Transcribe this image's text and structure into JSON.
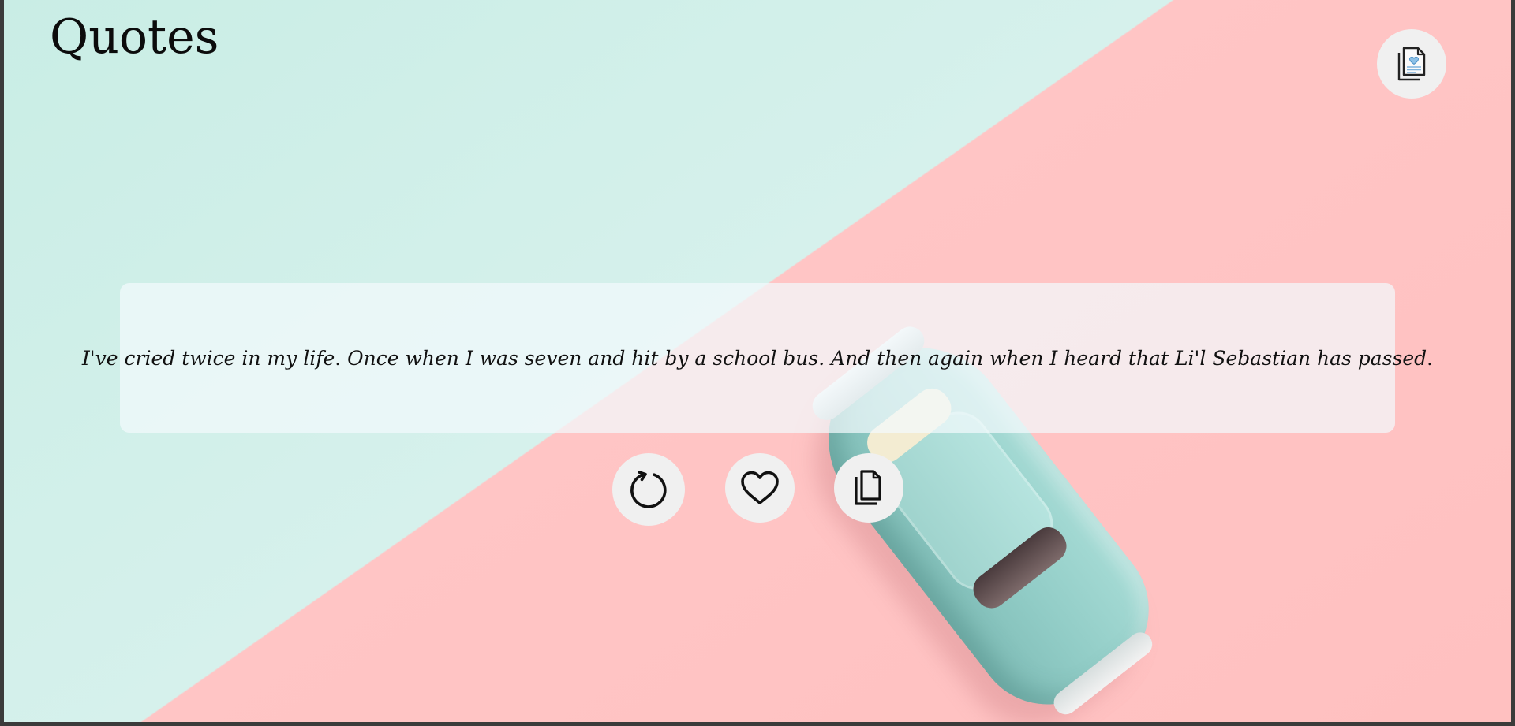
{
  "app": {
    "title": "Quotes"
  },
  "quote": {
    "text": "I've cried twice in my life. Once when I was seven and hit by a school bus. And then again when I heard that Li'l Sebastian has passed."
  },
  "actions": [
    {
      "name": "refresh",
      "icon": "refresh-icon"
    },
    {
      "name": "like",
      "icon": "heart-icon"
    },
    {
      "name": "copy",
      "icon": "copy-icon"
    }
  ],
  "header": {
    "favorites_icon": "favorites-list-icon"
  },
  "colors": {
    "background_mint": "#c9ede5",
    "background_pink": "#ffc5c5",
    "button_bg": "#f0f0f0",
    "card_bg": "#f2fafc",
    "accent_blue": "#4a90c8"
  }
}
